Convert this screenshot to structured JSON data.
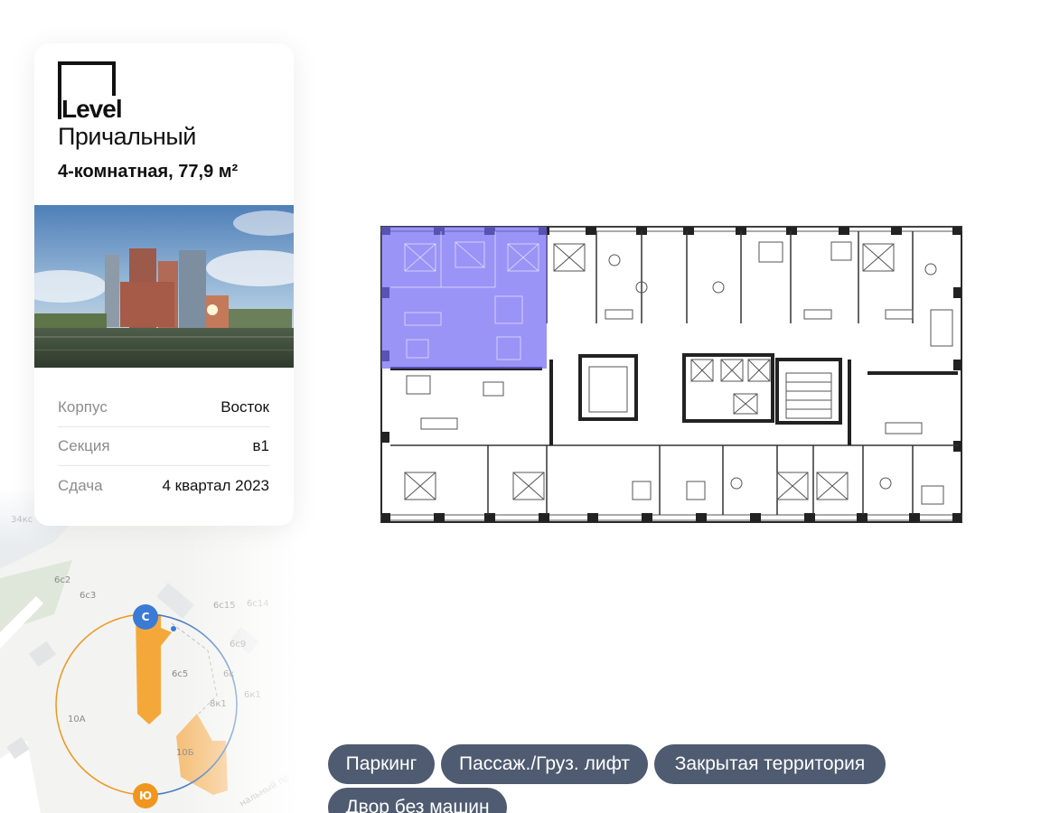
{
  "brand": {
    "logo_word": "Level",
    "project_name": "Причальный"
  },
  "apartment": {
    "title": "4-комнатная, 77,9 м²"
  },
  "details": [
    {
      "key": "Корпус",
      "value": "Восток"
    },
    {
      "key": "Секция",
      "value": "в1"
    },
    {
      "key": "Сдача",
      "value": "4 квартал 2023"
    }
  ],
  "map": {
    "north_label": "С",
    "south_label": "Ю",
    "building_labels": [
      "34кс",
      "6с2",
      "6с3",
      "6с15",
      "6с14",
      "6с9",
      "6с5",
      "6к",
      "6к1",
      "8к1",
      "10А",
      "10Б",
      "нальный пр"
    ]
  },
  "colors": {
    "highlight": "#6f66f2",
    "chip_bg": "#4e5b70",
    "compass_north": "#3a7bd5",
    "compass_south": "#f0961e",
    "building_orange": "#f5a83a"
  },
  "features": [
    "Паркинг",
    "Пассаж./Груз. лифт",
    "Закрытая территория",
    "Двор без машин"
  ]
}
